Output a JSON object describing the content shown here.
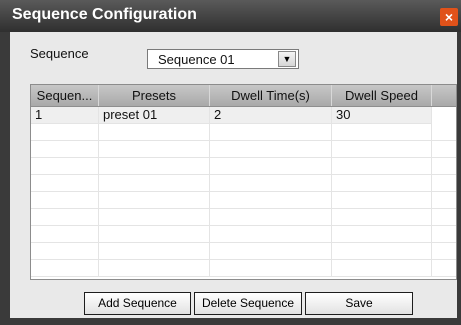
{
  "dialog": {
    "title": "Sequence Configuration",
    "close_glyph": "×"
  },
  "sequence_selector": {
    "label": "Sequence",
    "value": "Sequence 01",
    "arrow_glyph": "▼"
  },
  "table": {
    "columns": [
      "Sequen...",
      "Presets",
      "Dwell Time(s)",
      "Dwell Speed"
    ],
    "rows": [
      [
        "1",
        "preset 01",
        "2",
        "30"
      ]
    ]
  },
  "buttons": {
    "add": "Add Sequence",
    "delete": "Delete Sequence",
    "save": "Save"
  },
  "colors": {
    "titlebar": "#3a3a3a",
    "close": "#e0521a",
    "panel": "#e9e9e9"
  }
}
